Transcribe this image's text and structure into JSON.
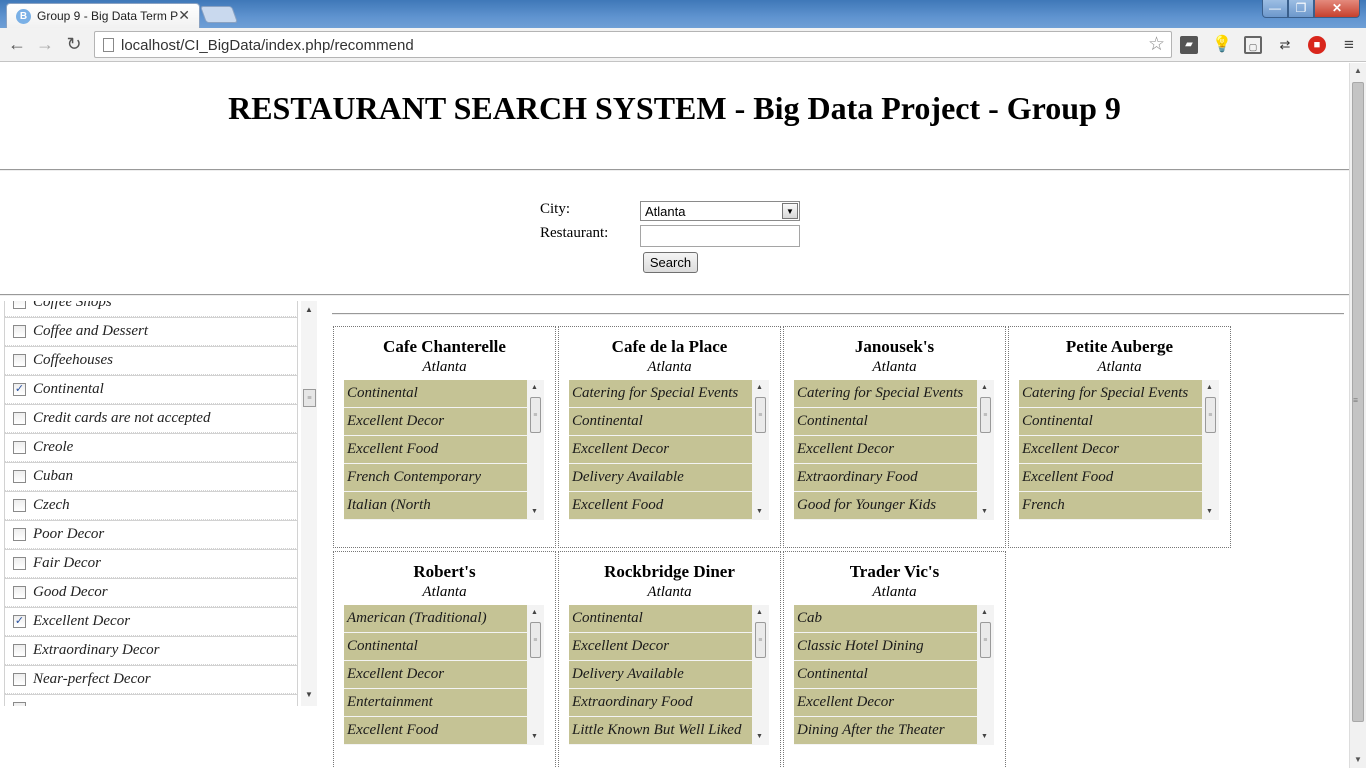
{
  "browser": {
    "tab_title": "Group 9 - Big Data Term P",
    "tab_favicon": "B",
    "tab_close": "✕",
    "url": "localhost/CI_BigData/index.php/recommend",
    "controls": {
      "minimize": "—",
      "maximize": "❐",
      "close": "✕"
    },
    "nav": {
      "back": "←",
      "forward": "→",
      "reload": "↻",
      "star": "☆",
      "menu": "≡"
    },
    "extensions": [
      "▰",
      "💡",
      "▢",
      "⇄",
      "■"
    ]
  },
  "page": {
    "title": "RESTAURANT SEARCH SYSTEM - Big Data Project - Group 9"
  },
  "search_form": {
    "city_label": "City:",
    "restaurant_label": "Restaurant:",
    "city_value": "Atlanta",
    "restaurant_value": "",
    "search_label": "Search"
  },
  "categories": [
    {
      "label": "Coffee Shops",
      "checked": false
    },
    {
      "label": "Coffee and Dessert",
      "checked": false
    },
    {
      "label": "Coffeehouses",
      "checked": false
    },
    {
      "label": "Continental",
      "checked": true
    },
    {
      "label": "Credit cards are not accepted",
      "checked": false
    },
    {
      "label": "Creole",
      "checked": false
    },
    {
      "label": "Cuban",
      "checked": false
    },
    {
      "label": "Czech",
      "checked": false
    },
    {
      "label": "Poor Decor",
      "checked": false
    },
    {
      "label": "Fair Decor",
      "checked": false
    },
    {
      "label": "Good Decor",
      "checked": false
    },
    {
      "label": "Excellent Decor",
      "checked": true
    },
    {
      "label": "Extraordinary Decor",
      "checked": false
    },
    {
      "label": "Near-perfect Decor",
      "checked": false
    },
    {
      "label": "",
      "checked": false
    }
  ],
  "results": [
    {
      "name": "Cafe Chanterelle",
      "city": "Atlanta",
      "tags": [
        "Continental",
        "Excellent Decor",
        "Excellent Food",
        "French Contemporary",
        "Italian (North"
      ]
    },
    {
      "name": "Cafe de la Place",
      "city": "Atlanta",
      "tags": [
        "Catering for Special Events",
        "Continental",
        "Excellent Decor",
        "Delivery Available",
        "Excellent Food"
      ]
    },
    {
      "name": "Janousek's",
      "city": "Atlanta",
      "tags": [
        "Catering for Special Events",
        "Continental",
        "Excellent Decor",
        "Extraordinary Food",
        "Good for Younger Kids"
      ]
    },
    {
      "name": "Petite Auberge",
      "city": "Atlanta",
      "tags": [
        "Catering for Special Events",
        "Continental",
        "Excellent Decor",
        "Excellent Food",
        "French"
      ]
    },
    {
      "name": "Robert's",
      "city": "Atlanta",
      "tags": [
        "American (Traditional)",
        "Continental",
        "Excellent Decor",
        "Entertainment",
        "Excellent Food"
      ]
    },
    {
      "name": "Rockbridge Diner",
      "city": "Atlanta",
      "tags": [
        "Continental",
        "Excellent Decor",
        "Delivery Available",
        "Extraordinary Food",
        "Little Known But Well Liked"
      ]
    },
    {
      "name": "Trader Vic's",
      "city": "Atlanta",
      "tags": [
        "Cab",
        "Classic Hotel Dining",
        "Continental",
        "Excellent Decor",
        "Dining After the Theater"
      ]
    }
  ],
  "scroll": {
    "up": "▲",
    "down": "▼",
    "grip": "≡"
  }
}
